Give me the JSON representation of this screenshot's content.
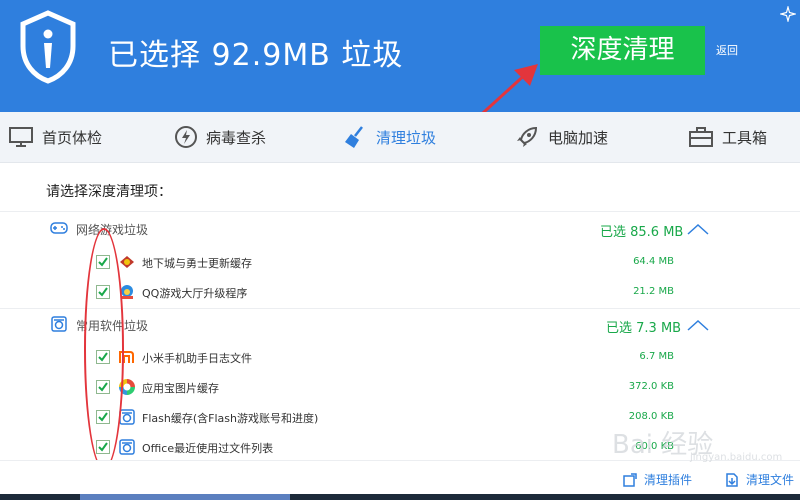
{
  "header": {
    "title": "已选择 92.9MB 垃圾",
    "deep_clean_label": "深度清理",
    "back_label": "返回"
  },
  "tabs": [
    {
      "label": "首页体检",
      "icon": "monitor-icon"
    },
    {
      "label": "病毒查杀",
      "icon": "lightning-icon"
    },
    {
      "label": "清理垃圾",
      "icon": "broom-icon",
      "active": true
    },
    {
      "label": "电脑加速",
      "icon": "rocket-icon"
    },
    {
      "label": "工具箱",
      "icon": "toolbox-icon"
    }
  ],
  "main": {
    "prompt": "请选择深度清理项：",
    "groups": [
      {
        "label": "网络游戏垃圾",
        "selected": "已选 85.6 MB",
        "icon": "gamepad-icon",
        "items": [
          {
            "label": "地下城与勇士更新缓存",
            "size": "64.4 MB",
            "checked": true,
            "icon": "dnf-game-icon"
          },
          {
            "label": "QQ游戏大厅升级程序",
            "size": "21.2 MB",
            "checked": true,
            "icon": "qq-game-icon"
          }
        ]
      },
      {
        "label": "常用软件垃圾",
        "selected": "已选 7.3 MB",
        "icon": "software-icon",
        "items": [
          {
            "label": "小米手机助手日志文件",
            "size": "6.7 MB",
            "checked": true,
            "icon": "xiaomi-icon"
          },
          {
            "label": "应用宝图片缓存",
            "size": "372.0 KB",
            "checked": true,
            "icon": "app-store-icon"
          },
          {
            "label": "Flash缓存(含Flash游戏账号和进度)",
            "size": "208.0 KB",
            "checked": true,
            "icon": "flash-icon"
          },
          {
            "label": "Office最近使用过文件列表",
            "size": "60.0 KB",
            "checked": true,
            "icon": "office-icon"
          }
        ]
      }
    ]
  },
  "bottom": {
    "clean_plugins": "清理插件",
    "clean_files": "清理文件"
  },
  "watermark": {
    "main": "Bai 经验",
    "sub": "jingyan.baidu.com"
  },
  "colors": {
    "header_blue": "#2f7fde",
    "button_green": "#19c24b",
    "size_green": "#19a84a",
    "annotation_red": "#e3353c"
  }
}
